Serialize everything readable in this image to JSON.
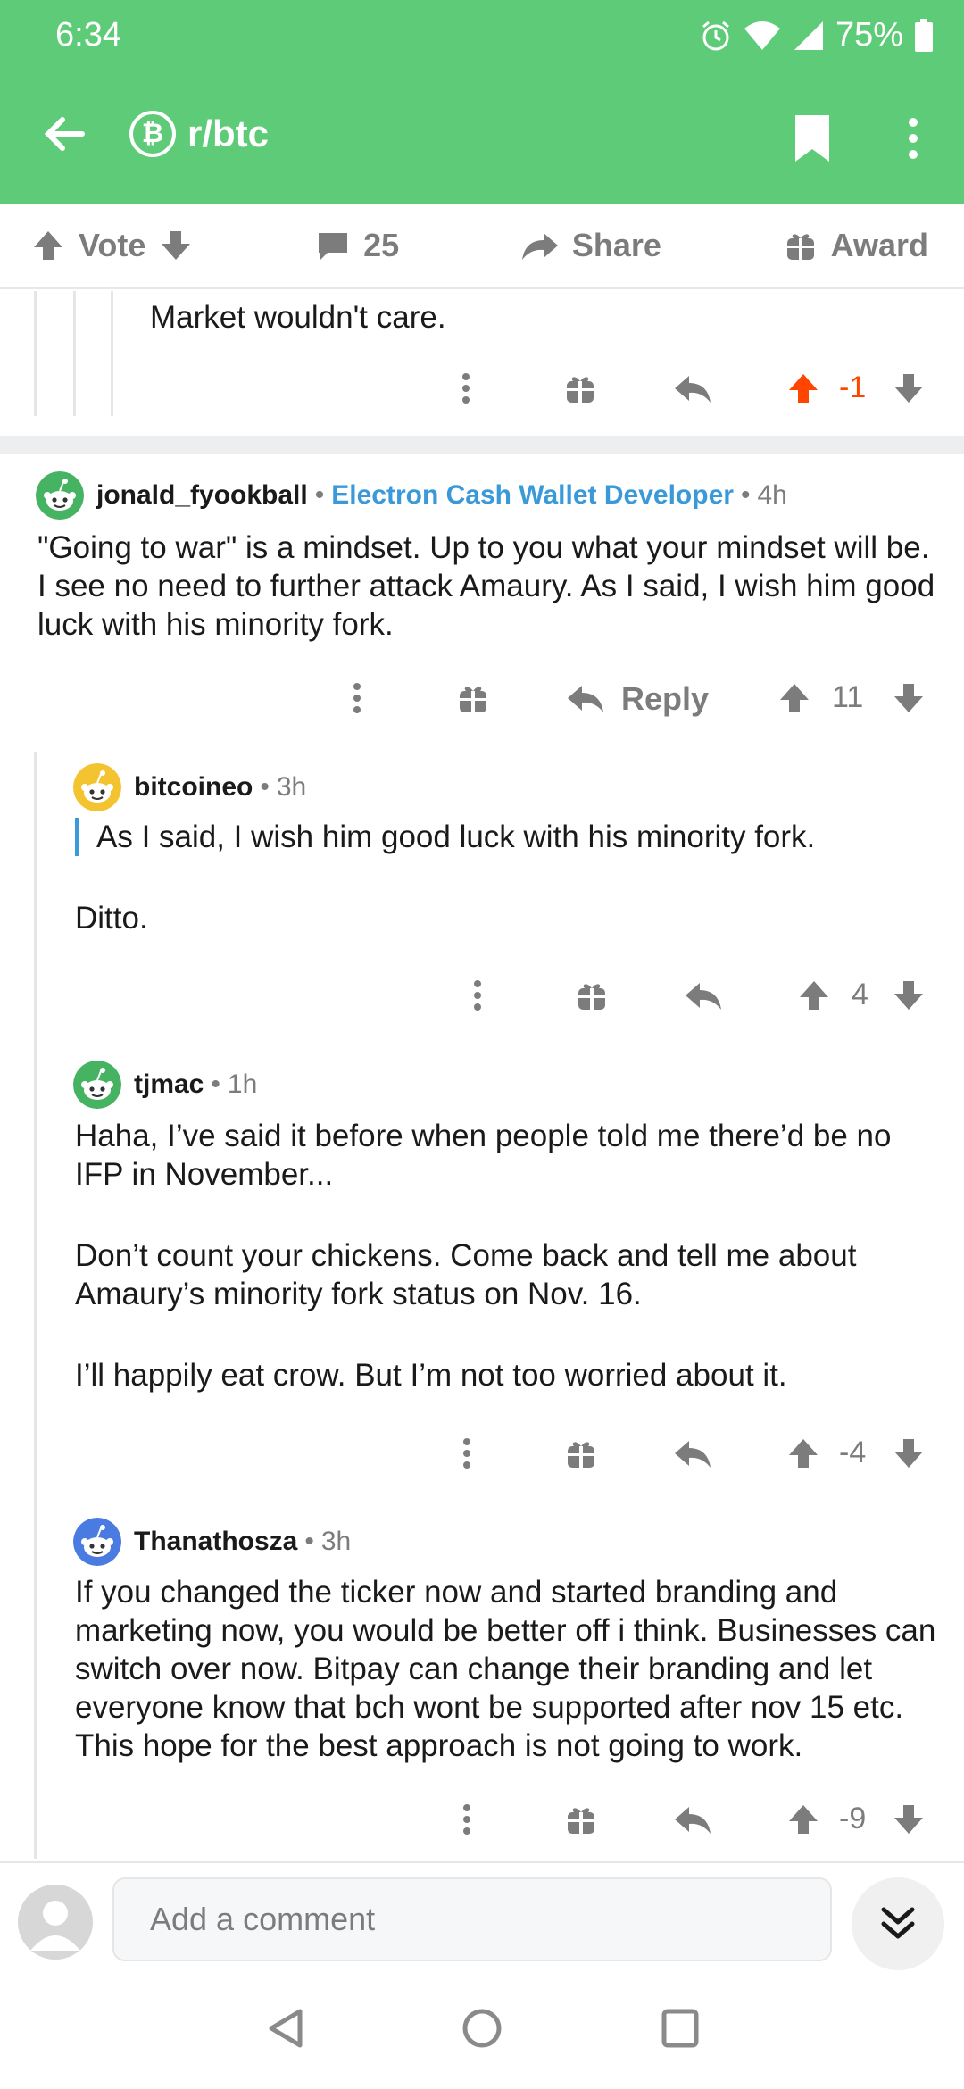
{
  "status": {
    "time": "6:34",
    "battery": "75%"
  },
  "header": {
    "subreddit": "r/btc",
    "sub_icon": "₿"
  },
  "action_bar": {
    "vote": "Vote",
    "comments": "25",
    "share": "Share",
    "award": "Award"
  },
  "comments": [
    {
      "id": "c0",
      "body": [
        "Market wouldn't care."
      ],
      "score": "-1",
      "upvoted": true
    },
    {
      "id": "c1",
      "user": "jonald_fyookball",
      "flair": "Electron Cash Wallet Developer",
      "time": "4h",
      "body": [
        "\"Going to war\" is a mindset.  Up to you what your mindset will be.  I see no need to further attack Amaury.  As I said, I wish him good luck with his minority fork."
      ],
      "reply_label": "Reply",
      "score": "11"
    },
    {
      "id": "c2",
      "user": "bitcoineo",
      "time": "3h",
      "quote": "As I said, I wish him good luck with his minority fork.",
      "body": [
        "Ditto."
      ],
      "score": "4"
    },
    {
      "id": "c3",
      "user": "tjmac",
      "time": "1h",
      "body": [
        "Haha, I’ve said it before when people told me there’d be no IFP in November...",
        "Don’t count your chickens. Come back and tell me about Amaury’s minority fork status on Nov. 16.",
        "I’ll happily eat crow. But I’m not too worried about it."
      ],
      "score": "-4"
    },
    {
      "id": "c4",
      "user": "Thanathosza",
      "time": "3h",
      "body": [
        "If you changed the ticker now and started branding and marketing now, you would be better off i think. Businesses can switch over now. Bitpay can change their branding and let everyone know that bch wont be supported after nov 15 etc. This hope for the best approach is not going to work."
      ],
      "score": "-9"
    }
  ],
  "composer": {
    "placeholder": "Add a comment"
  },
  "colors": {
    "brand": "#5dcb77",
    "orange": "#ff4500",
    "flair": "#3a9ad9",
    "gray": "#7c7c7c"
  }
}
